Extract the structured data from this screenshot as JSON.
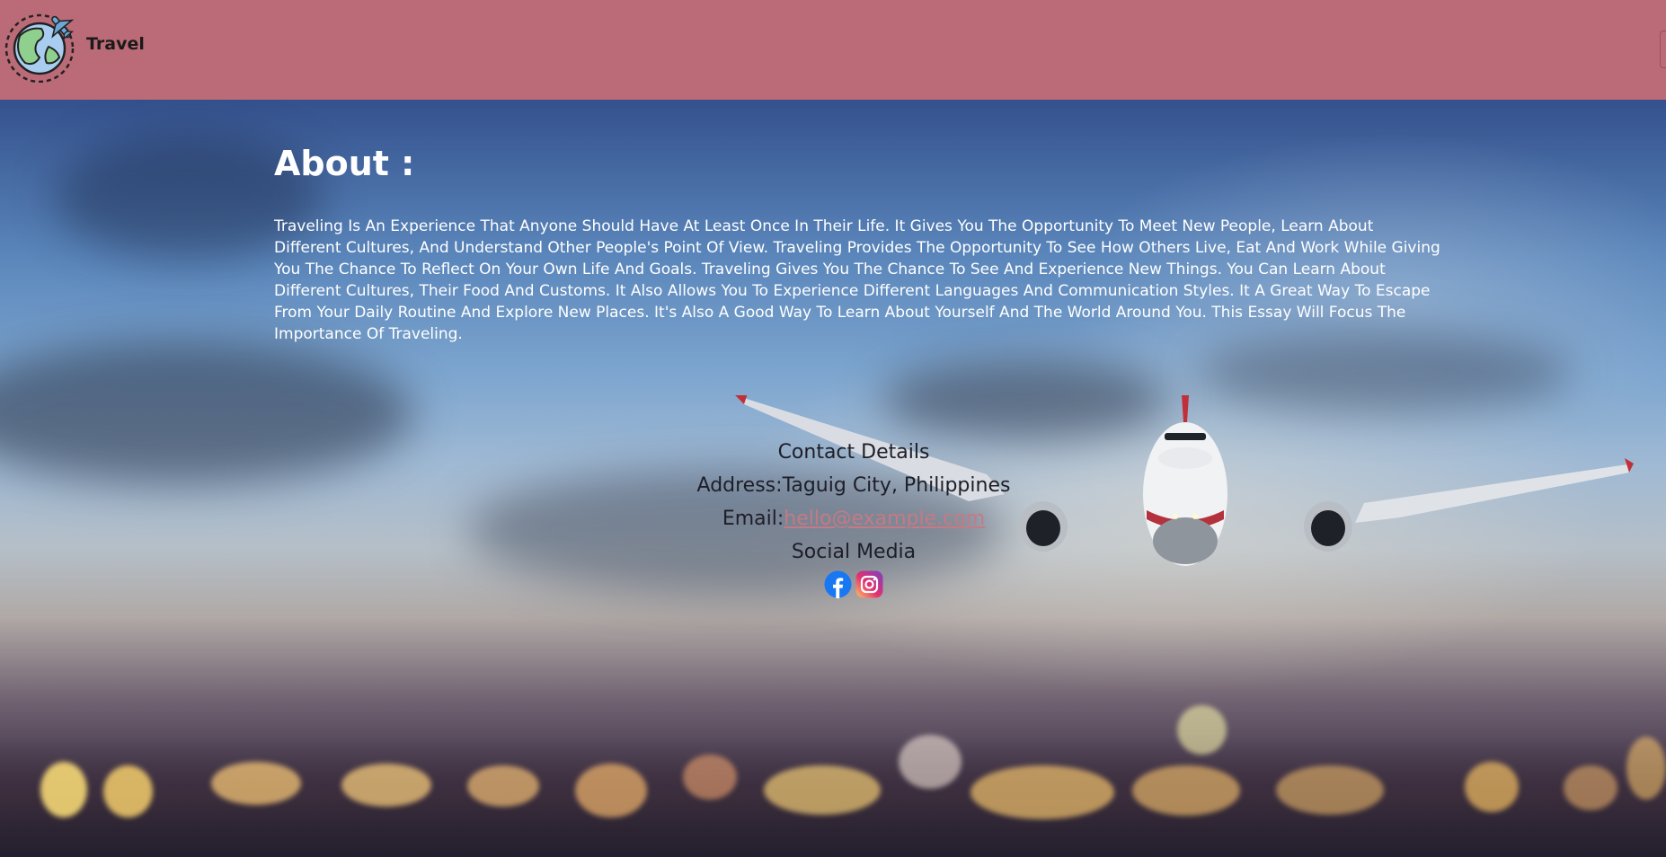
{
  "header": {
    "brand": "Travel",
    "logo_icon": "globe-airplane-icon",
    "background_color": "#bb6b77"
  },
  "about": {
    "title": "About :",
    "body": "Traveling Is An Experience That Anyone Should Have At Least Once In Their Life. It Gives You The Opportunity To Meet New People, Learn About Different Cultures, And Understand Other People's Point Of View. Traveling Provides The Opportunity To See How Others Live, Eat And Work While Giving You The Chance To Reflect On Your Own Life And Goals. Traveling Gives You The Chance To See And Experience New Things. You Can Learn About Different Cultures, Their Food And Customs. It Also Allows You To Experience Different Languages And Communication Styles. It A Great Way To Escape From Your Daily Routine And Explore New Places. It's Also A Good Way To Learn About Yourself And The World Around You. This Essay Will Focus The Importance Of Traveling."
  },
  "contact": {
    "heading": "Contact Details",
    "address_label": "Address:",
    "address_value": "Taguig City, Philippines",
    "email_label": "Email:",
    "email_value": "hello@example.com",
    "social_heading": "Social Media",
    "social_links": [
      {
        "icon": "facebook-icon",
        "color": "#1877f2"
      },
      {
        "icon": "instagram-icon",
        "color": "#d6249f"
      }
    ],
    "link_color": "#c57a84"
  },
  "background": {
    "scene": "airplane taking off at dusk with blurred city lights"
  }
}
